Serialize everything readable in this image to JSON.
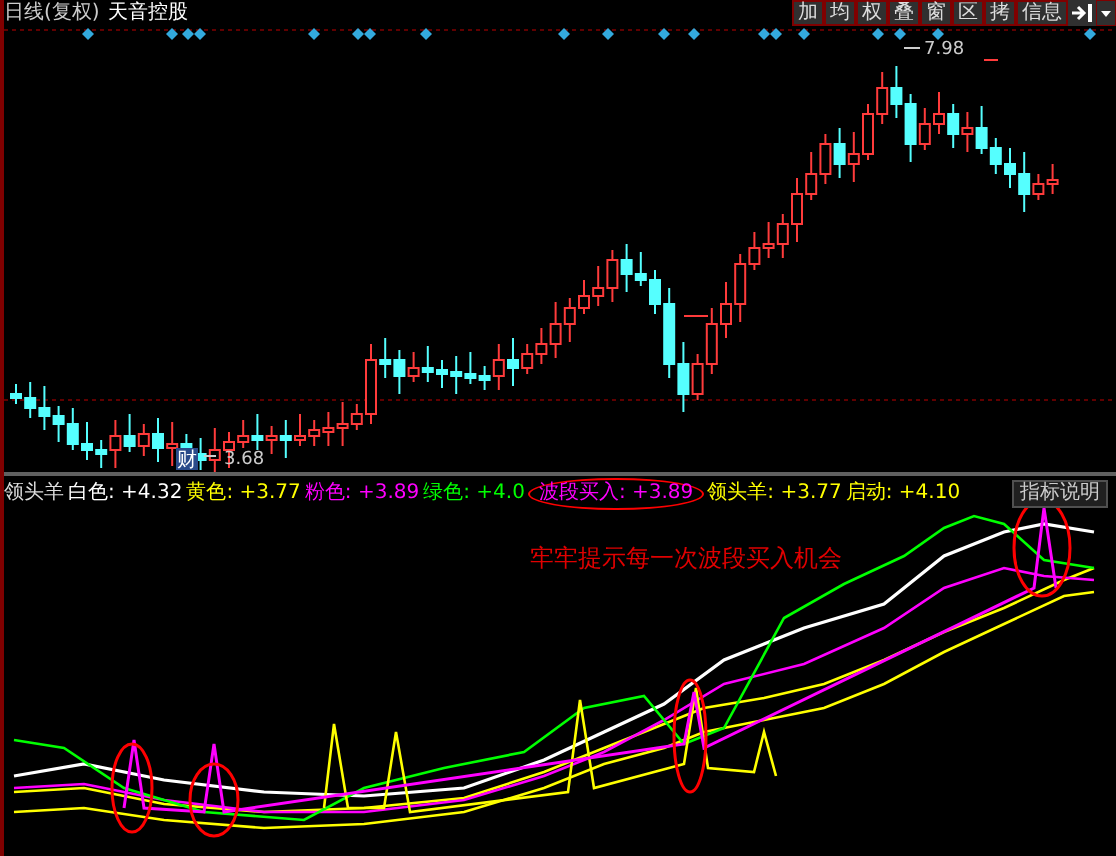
{
  "title": "日线(复权)",
  "stock_name": "天音控股",
  "toolbar": [
    {
      "label": "加"
    },
    {
      "label": "均"
    },
    {
      "label": "权"
    },
    {
      "label": "叠"
    },
    {
      "label": "窗"
    },
    {
      "label": "区"
    },
    {
      "label": "拷"
    },
    {
      "label": "信息"
    }
  ],
  "price_labels": {
    "high": "7.98",
    "low": "3.68"
  },
  "event_badge": "财",
  "indicator": {
    "name": "领头羊",
    "values": [
      {
        "label": "白色:",
        "value": "+4.32",
        "color": "#ffffff",
        "circled": false
      },
      {
        "label": "黄色:",
        "value": "+3.77",
        "color": "#ffff00",
        "circled": false
      },
      {
        "label": "粉色:",
        "value": "+3.89",
        "color": "#ff00ff",
        "circled": false
      },
      {
        "label": "绿色:",
        "value": "+4.0",
        "color": "#00ff00",
        "circled": false
      },
      {
        "label": "波段买入:",
        "value": "+3.89",
        "color": "#ff00ff",
        "circled": true
      },
      {
        "label": "领头羊:",
        "value": "+3.77",
        "color": "#ffff00",
        "circled": false
      },
      {
        "label": "启动:",
        "value": "+4.10",
        "color": "#ffff00",
        "circled": false
      }
    ],
    "help_button": "指标说明",
    "annotation": "牢牢提示每一次波段买入机会"
  }
}
